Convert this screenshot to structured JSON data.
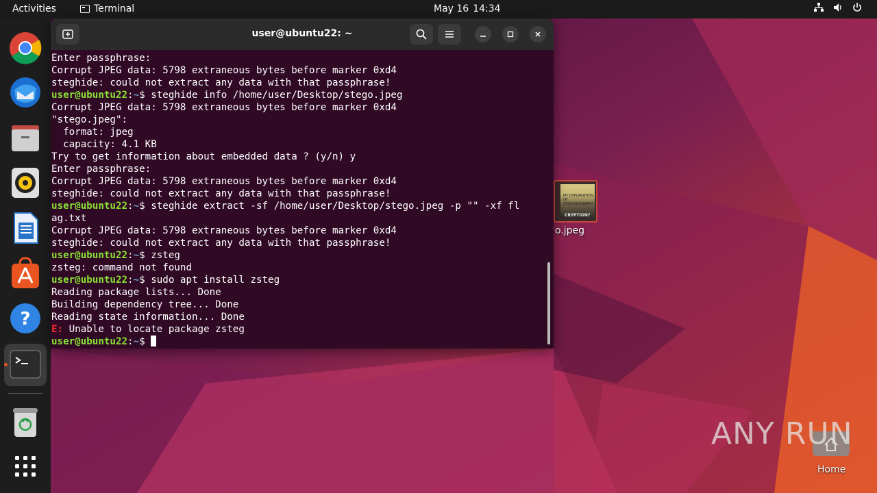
{
  "topbar": {
    "activities": "Activities",
    "app_name": "Terminal",
    "date": "May 16",
    "time": "14:34",
    "tray_icons": [
      "network-icon",
      "volume-icon",
      "power-icon"
    ]
  },
  "dock": {
    "items": [
      {
        "name": "chrome-icon"
      },
      {
        "name": "thunderbird-icon"
      },
      {
        "name": "files-icon"
      },
      {
        "name": "rhythmbox-icon"
      },
      {
        "name": "writer-icon"
      },
      {
        "name": "app-center-icon"
      },
      {
        "name": "help-icon"
      },
      {
        "name": "terminal-icon"
      },
      {
        "name": "trash-icon"
      },
      {
        "name": "show-apps-icon"
      }
    ]
  },
  "desktop": {
    "file_label": "o.jpeg",
    "file_thumb_text": [
      "MY EXPLANATION",
      "OF STEGANOGRAPHY",
      "CRYPTION?"
    ],
    "home_label": "Home",
    "watermark": "ANY RUN"
  },
  "terminal": {
    "title": "user@ubuntu22: ~",
    "prompt_user": "user@ubuntu22",
    "prompt_sep": ":",
    "prompt_path": "~",
    "prompt_dollar": "$",
    "lines": [
      {
        "kind": "out",
        "text": "Enter passphrase:"
      },
      {
        "kind": "out",
        "text": "Corrupt JPEG data: 5798 extraneous bytes before marker 0xd4"
      },
      {
        "kind": "out",
        "text": "steghide: could not extract any data with that passphrase!"
      },
      {
        "kind": "cmd",
        "text": " steghide info /home/user/Desktop/stego.jpeg"
      },
      {
        "kind": "out",
        "text": "Corrupt JPEG data: 5798 extraneous bytes before marker 0xd4"
      },
      {
        "kind": "out",
        "text": "\"stego.jpeg\":"
      },
      {
        "kind": "out",
        "text": "  format: jpeg"
      },
      {
        "kind": "out",
        "text": "  capacity: 4.1 KB"
      },
      {
        "kind": "out",
        "text": "Try to get information about embedded data ? (y/n) y"
      },
      {
        "kind": "out",
        "text": "Enter passphrase:"
      },
      {
        "kind": "out",
        "text": "Corrupt JPEG data: 5798 extraneous bytes before marker 0xd4"
      },
      {
        "kind": "out",
        "text": "steghide: could not extract any data with that passphrase!"
      },
      {
        "kind": "cmd",
        "text": " steghide extract -sf /home/user/Desktop/stego.jpeg -p \"\" -xf fl"
      },
      {
        "kind": "out",
        "text": "ag.txt"
      },
      {
        "kind": "out",
        "text": "Corrupt JPEG data: 5798 extraneous bytes before marker 0xd4"
      },
      {
        "kind": "out",
        "text": "steghide: could not extract any data with that passphrase!"
      },
      {
        "kind": "cmd",
        "text": " zsteg"
      },
      {
        "kind": "out",
        "text": "zsteg: command not found"
      },
      {
        "kind": "cmd",
        "text": " sudo apt install zsteg"
      },
      {
        "kind": "out",
        "text": "Reading package lists... Done"
      },
      {
        "kind": "out",
        "text": "Building dependency tree... Done"
      },
      {
        "kind": "out",
        "text": "Reading state information... Done"
      },
      {
        "kind": "err",
        "prefix": "E:",
        "text": " Unable to locate package zsteg"
      },
      {
        "kind": "cmd",
        "text": " "
      }
    ]
  }
}
